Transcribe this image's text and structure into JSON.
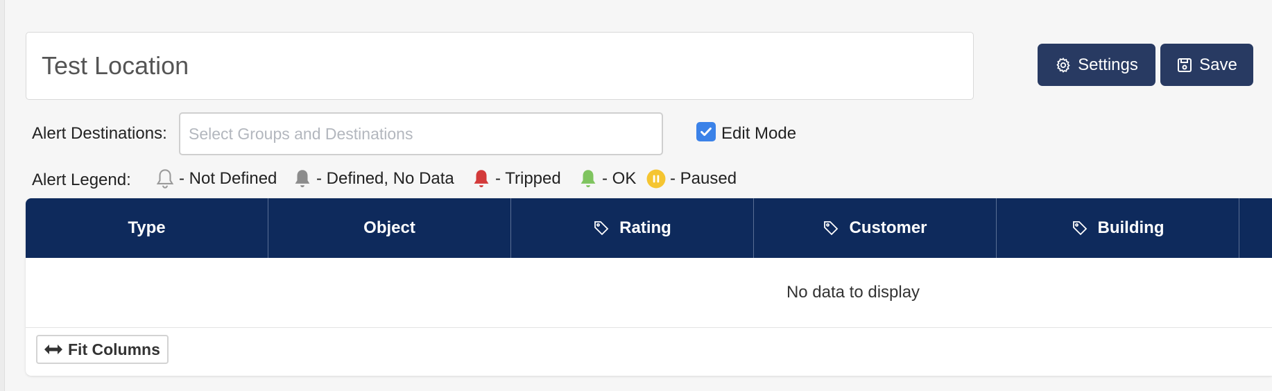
{
  "location": {
    "name": "Test Location"
  },
  "toolbar": {
    "settings_label": "Settings",
    "save_label": "Save"
  },
  "alert_destinations": {
    "label": "Alert Destinations:",
    "placeholder": "Select Groups and Destinations"
  },
  "edit_mode": {
    "label": "Edit Mode",
    "checked": true
  },
  "legend": {
    "label": "Alert Legend:",
    "items": [
      {
        "icon": "bell-outline-icon",
        "text": "- Not Defined",
        "color": "#9a9a9a"
      },
      {
        "icon": "bell-icon",
        "text": "- Defined, No Data",
        "color": "#8c8c8c"
      },
      {
        "icon": "bell-icon",
        "text": "- Tripped",
        "color": "#d33a3a"
      },
      {
        "icon": "bell-icon",
        "text": "- OK",
        "color": "#7fc45f"
      },
      {
        "icon": "pause-circle-icon",
        "text": "- Paused",
        "color": "#f5c531"
      }
    ]
  },
  "grid": {
    "columns": [
      {
        "label": "Type",
        "icon": ""
      },
      {
        "label": "Object",
        "icon": ""
      },
      {
        "label": "Rating",
        "icon": "tag-icon"
      },
      {
        "label": "Customer",
        "icon": "tag-icon"
      },
      {
        "label": "Building",
        "icon": "tag-icon"
      }
    ],
    "empty_text": "No data to display",
    "fit_columns_label": "Fit Columns",
    "header_color": "#0e2a5c"
  },
  "colors": {
    "button": "#283a62",
    "checkbox": "#3b82e8"
  }
}
